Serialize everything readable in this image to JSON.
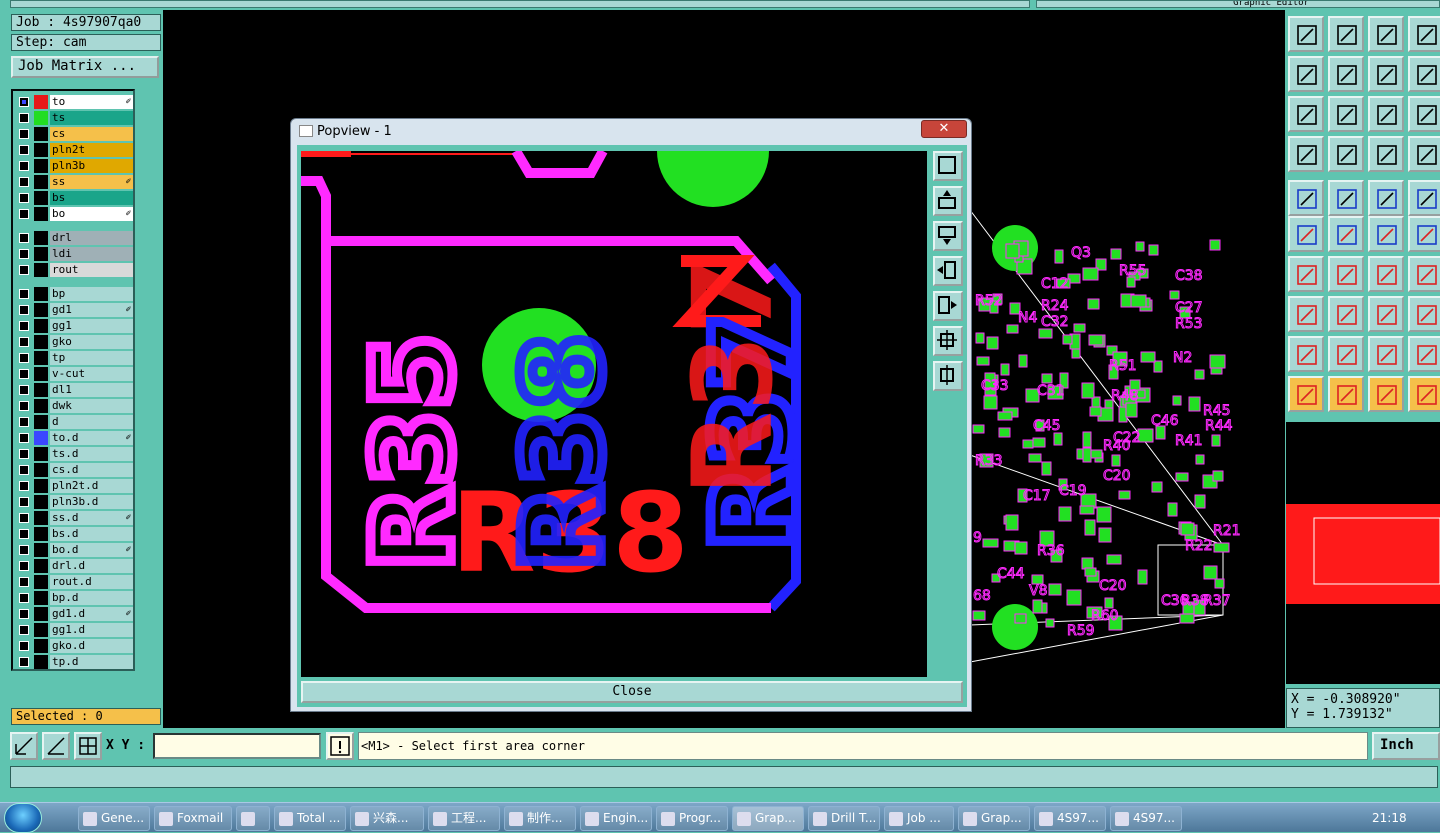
{
  "app": {
    "top_right_title": "Graphic Editor"
  },
  "job": {
    "job_label": "Job : 4s97907qa0",
    "step_label": "Step: cam",
    "matrix_button": "Job Matrix ..."
  },
  "layers": {
    "group1": [
      {
        "name": "to",
        "color": "#e81818",
        "edit": true,
        "row_bg": "#ffffff",
        "sel": true
      },
      {
        "name": "ts",
        "color": "#22dd22",
        "edit": false,
        "row_bg": "#1aa58a",
        "sel": false
      },
      {
        "name": "cs",
        "color": "#000000",
        "edit": false,
        "row_bg": "#f5c04a",
        "sel": false
      },
      {
        "name": "pln2t",
        "color": "#000000",
        "edit": false,
        "row_bg": "#e0a800",
        "sel": false
      },
      {
        "name": "pln3b",
        "color": "#000000",
        "edit": false,
        "row_bg": "#e0a800",
        "sel": false
      },
      {
        "name": "ss",
        "color": "#000000",
        "edit": true,
        "row_bg": "#f5c04a",
        "sel": false
      },
      {
        "name": "bs",
        "color": "#000000",
        "edit": false,
        "row_bg": "#1aa58a",
        "sel": false
      },
      {
        "name": "bo",
        "color": "#000000",
        "edit": true,
        "row_bg": "#ffffff",
        "sel": false
      }
    ],
    "group2": [
      {
        "name": "drl",
        "color": "#000000",
        "edit": false,
        "row_bg": "#9fb0b6",
        "sel": false
      },
      {
        "name": "ldi",
        "color": "#000000",
        "edit": false,
        "row_bg": "#9fb0b6",
        "sel": false
      },
      {
        "name": "rout",
        "color": "#000000",
        "edit": false,
        "row_bg": "#d9d9d9",
        "sel": false
      }
    ],
    "group3": [
      {
        "name": "bp",
        "color": "#000000",
        "edit": false,
        "row_bg": "#a8d8d4"
      },
      {
        "name": "gd1",
        "color": "#000000",
        "edit": true,
        "row_bg": "#a8d8d4"
      },
      {
        "name": "gg1",
        "color": "#000000",
        "edit": false,
        "row_bg": "#a8d8d4"
      },
      {
        "name": "gko",
        "color": "#000000",
        "edit": false,
        "row_bg": "#a8d8d4"
      },
      {
        "name": "tp",
        "color": "#000000",
        "edit": false,
        "row_bg": "#a8d8d4"
      },
      {
        "name": "v-cut",
        "color": "#000000",
        "edit": false,
        "row_bg": "#a8d8d4"
      },
      {
        "name": "dl1",
        "color": "#000000",
        "edit": false,
        "row_bg": "#a8d8d4"
      },
      {
        "name": "dwk",
        "color": "#000000",
        "edit": false,
        "row_bg": "#a8d8d4"
      },
      {
        "name": "d",
        "color": "#000000",
        "edit": false,
        "row_bg": "#a8d8d4"
      },
      {
        "name": "to.d",
        "color": "#3b47ff",
        "edit": true,
        "row_bg": "#a8d8d4"
      },
      {
        "name": "ts.d",
        "color": "#000000",
        "edit": false,
        "row_bg": "#a8d8d4"
      },
      {
        "name": "cs.d",
        "color": "#000000",
        "edit": false,
        "row_bg": "#a8d8d4"
      },
      {
        "name": "pln2t.d",
        "color": "#000000",
        "edit": false,
        "row_bg": "#a8d8d4"
      },
      {
        "name": "pln3b.d",
        "color": "#000000",
        "edit": false,
        "row_bg": "#a8d8d4"
      },
      {
        "name": "ss.d",
        "color": "#000000",
        "edit": true,
        "row_bg": "#a8d8d4"
      },
      {
        "name": "bs.d",
        "color": "#000000",
        "edit": false,
        "row_bg": "#a8d8d4"
      },
      {
        "name": "bo.d",
        "color": "#000000",
        "edit": true,
        "row_bg": "#a8d8d4"
      },
      {
        "name": "drl.d",
        "color": "#000000",
        "edit": false,
        "row_bg": "#a8d8d4"
      },
      {
        "name": "rout.d",
        "color": "#000000",
        "edit": false,
        "row_bg": "#a8d8d4"
      },
      {
        "name": "bp.d",
        "color": "#000000",
        "edit": false,
        "row_bg": "#a8d8d4"
      },
      {
        "name": "gd1.d",
        "color": "#000000",
        "edit": true,
        "row_bg": "#a8d8d4"
      },
      {
        "name": "gg1.d",
        "color": "#000000",
        "edit": false,
        "row_bg": "#a8d8d4"
      },
      {
        "name": "gko.d",
        "color": "#000000",
        "edit": false,
        "row_bg": "#a8d8d4"
      },
      {
        "name": "tp.d",
        "color": "#000000",
        "edit": false,
        "row_bg": "#a8d8d4"
      }
    ]
  },
  "selected": "Selected : 0",
  "popview": {
    "title": "Popview - 1",
    "close_label": "Close"
  },
  "pcb_labels": [
    "R35",
    "R38",
    "R37",
    "R38",
    "R37"
  ],
  "board_labels": [
    "Q3",
    "R55",
    "C38",
    "C12",
    "C27",
    "R24",
    "R53",
    "C32",
    "R52",
    "N4",
    "R51",
    "R48",
    "R44",
    "R45",
    "N2",
    "C33",
    "C31",
    "C46",
    "C45",
    "C22",
    "R40",
    "R41",
    "R33",
    "C20",
    "C17",
    "C19",
    "R36",
    "R22",
    "R21",
    "C44",
    "C20",
    "V8",
    "R60",
    "R59",
    "C36",
    "R38",
    "R37",
    "68",
    "9"
  ],
  "coords": {
    "x": "X = -0.308920\"",
    "y": "Y = 1.739132\""
  },
  "cmd": {
    "xy_label": "X Y :",
    "message": "<M1> - Select first area corner",
    "unit": "Inch"
  },
  "taskbar": {
    "items": [
      "Gene...",
      "Foxmail",
      "",
      "Total ...",
      "兴森...",
      "工程...",
      "制作...",
      "Engin...",
      "Progr...",
      "Grap...",
      "Drill T...",
      "Job ...",
      "Grap...",
      "4S97...",
      "4S97..."
    ],
    "clock": "21:18"
  },
  "colors": {
    "bg": "#5fc4b0",
    "panel": "#a8d8d4",
    "top_layer": "#ff1a1a",
    "mask_layer": "#22e022",
    "silk_top": "#ff2aff",
    "silk_bottom": "#2222ff"
  }
}
